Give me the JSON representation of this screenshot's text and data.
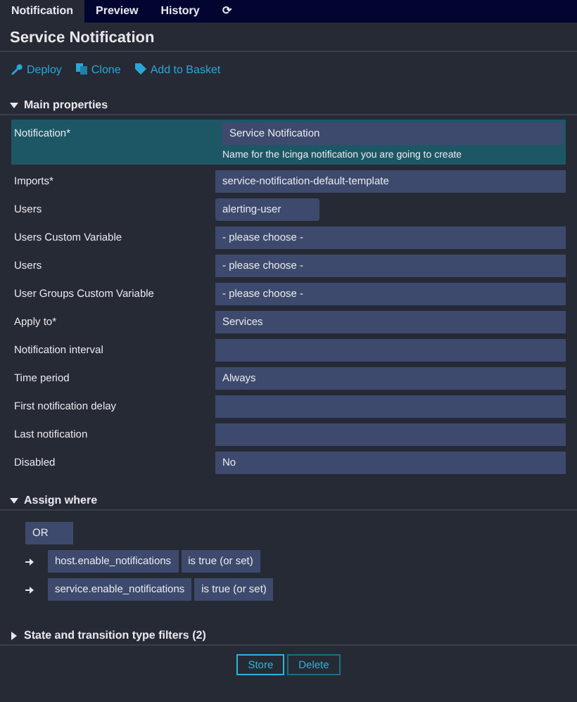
{
  "tabs": [
    {
      "label": "Notification",
      "selected": true
    },
    {
      "label": "Preview",
      "selected": false
    },
    {
      "label": "History",
      "selected": false
    },
    {
      "label": "⟳",
      "selected": false
    }
  ],
  "title": "Service Notification",
  "actions": [
    {
      "label": "Deploy",
      "kind": "deploy"
    },
    {
      "label": "Clone",
      "kind": "clone"
    },
    {
      "label": "Add to Basket",
      "kind": "basket"
    }
  ],
  "main_properties": {
    "title": "Main properties",
    "expanded": true,
    "fields": [
      {
        "label": "Notification*",
        "value": "Service Notification",
        "hint": "Name for the Icinga notification you are going to create",
        "focused": true,
        "kind": "text"
      },
      {
        "label": "Imports*",
        "value": "service-notification-default-template",
        "focused": false,
        "kind": "text"
      },
      {
        "label": "Users",
        "value": "alerting-user",
        "focused": false,
        "kind": "tag"
      },
      {
        "label": "Users Custom Variable",
        "value": "- please choose -",
        "focused": false,
        "kind": "text"
      },
      {
        "label": "Users",
        "value": "- please choose -",
        "focused": false,
        "kind": "text"
      },
      {
        "label": "User Groups Custom Variable",
        "value": "- please choose -",
        "focused": false,
        "kind": "text"
      },
      {
        "label": "Apply to*",
        "value": "Services",
        "focused": false,
        "kind": "text"
      },
      {
        "label": "Notification interval",
        "focused": false,
        "kind": "text"
      },
      {
        "label": "Time period",
        "value": "Always",
        "focused": false,
        "kind": "text"
      },
      {
        "label": "First notification delay",
        "focused": false,
        "kind": "text"
      },
      {
        "label": "Last notification",
        "focused": false,
        "kind": "text"
      },
      {
        "label": "Disabled",
        "value": "No",
        "focused": false,
        "kind": "text"
      }
    ]
  },
  "assign_where": {
    "title": "Assign where",
    "expanded": true,
    "operator": "OR",
    "conditions": [
      {
        "field": "host.enable_notifications",
        "test": "is true (or set)"
      },
      {
        "field": "service.enable_notifications",
        "test": "is true (or set)"
      }
    ]
  },
  "filters_section": {
    "title": "State and transition type filters (2)",
    "expanded": false
  },
  "buttons": [
    "Store",
    "Delete"
  ]
}
